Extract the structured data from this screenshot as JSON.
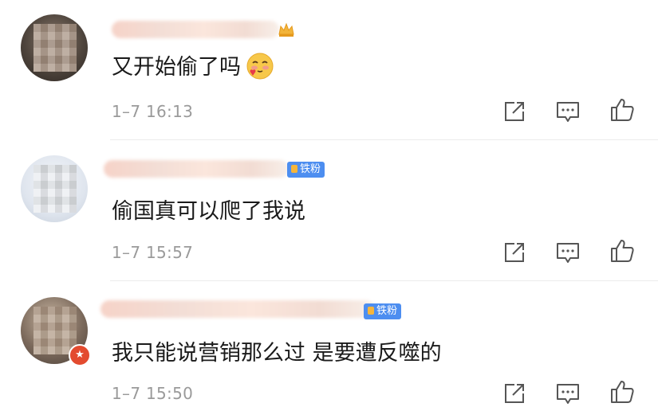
{
  "comments": [
    {
      "text": "又开始偷了吗",
      "time": "1–7 16:13",
      "emoji": "blush-heart-emoji",
      "username_badge": ""
    },
    {
      "text": "偷国真可以爬了我说",
      "time": "1–7 15:57",
      "username_badge": "铁粉"
    },
    {
      "text": "我只能说营销那么过 是要遭反噬的",
      "time": "1–7 15:50",
      "username_badge": "铁粉"
    }
  ],
  "icons": {
    "share": "share-icon",
    "comment": "comment-icon",
    "like": "thumbs-up-icon"
  },
  "colors": {
    "text": "#1a1a1a",
    "meta": "#9a9a9a",
    "fan_badge": "#4d8ef0",
    "verified_badge": "#e34b2f"
  }
}
